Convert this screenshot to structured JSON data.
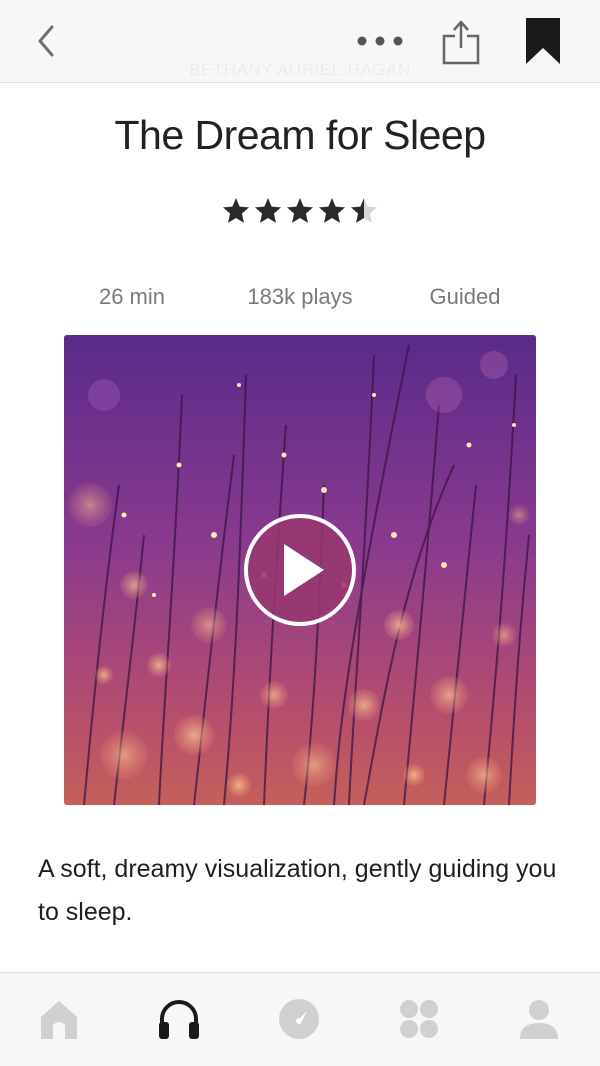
{
  "header": {
    "back_icon": "chevron-left-icon",
    "more_icon": "ellipsis-icon",
    "share_icon": "share-icon",
    "bookmark_icon": "bookmark-filled-icon",
    "watermark": "BETHANY AURIEL-HAGAN"
  },
  "session": {
    "title": "The Dream for Sleep",
    "rating": 4.5,
    "rating_max": 5,
    "duration": "26 min",
    "plays": "183k plays",
    "type": "Guided",
    "description": "A soft, dreamy visualization, gently guiding you to sleep.",
    "artwork_icon": "purple-bokeh-grass-image",
    "play_icon": "play-icon"
  },
  "tabbar": {
    "items": [
      {
        "icon": "home-icon",
        "active": false
      },
      {
        "icon": "headphones-icon",
        "active": true
      },
      {
        "icon": "compass-icon",
        "active": false
      },
      {
        "icon": "apps-grid-icon",
        "active": false
      },
      {
        "icon": "profile-icon",
        "active": false
      }
    ]
  },
  "colors": {
    "accent_active": "#1a1a1a",
    "inactive_icon": "#d0d0d0",
    "meta_text": "#7a7a7a",
    "play_button": "#963770"
  }
}
